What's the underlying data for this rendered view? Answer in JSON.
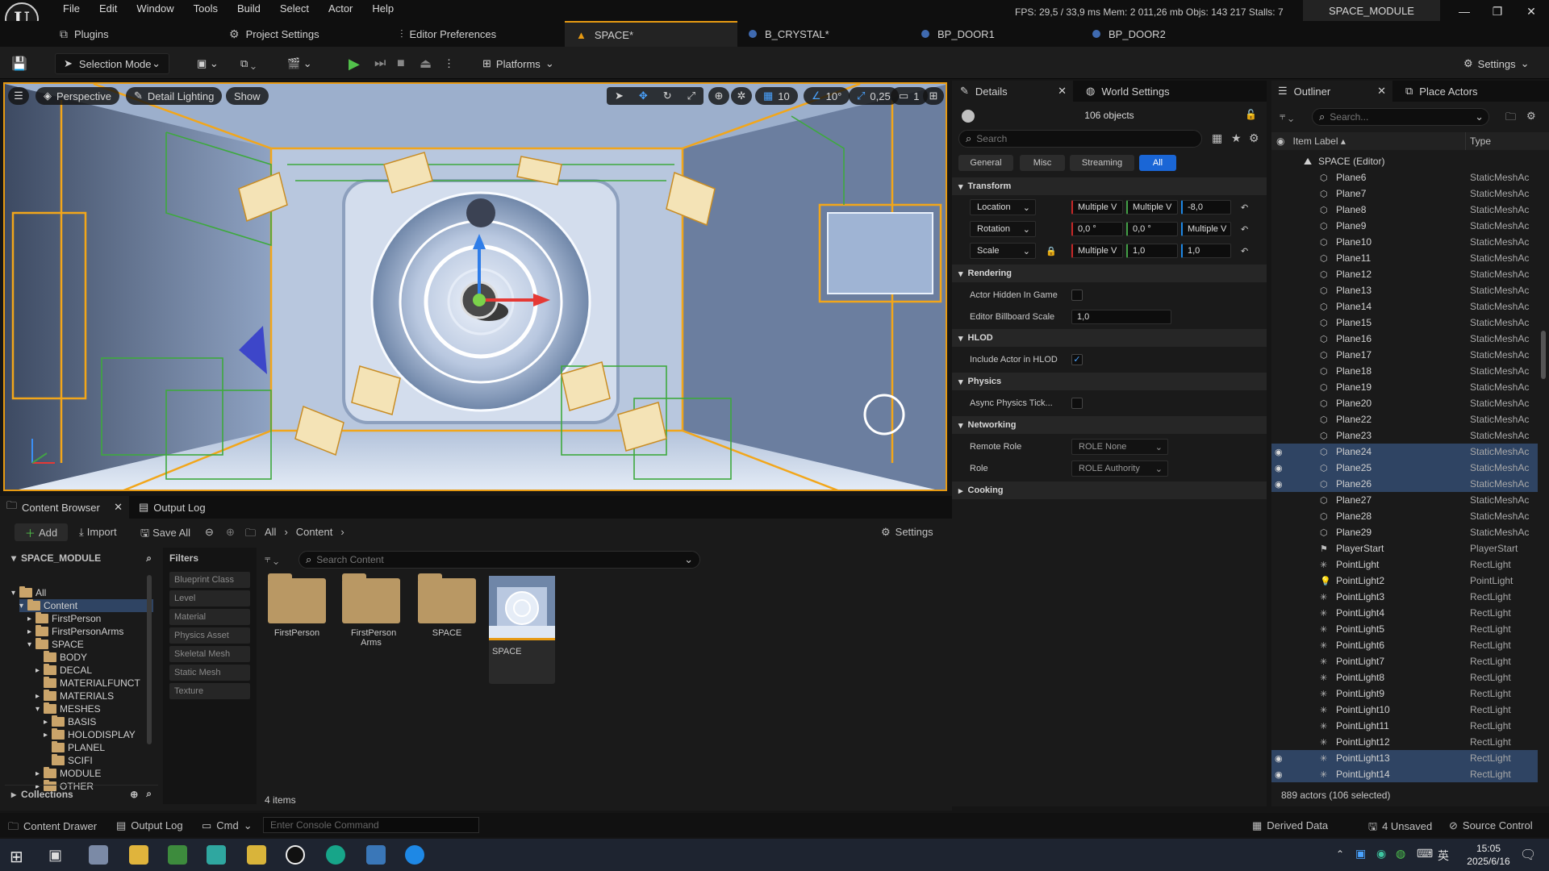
{
  "menu": [
    "File",
    "Edit",
    "Window",
    "Tools",
    "Build",
    "Select",
    "Actor",
    "Help"
  ],
  "stats": "FPS: 29,5  /  33,9 ms  Mem: 2 011,26 mb  Objs: 143 217  Stalls: 7",
  "project_name": "SPACE_MODULE",
  "toptabs": {
    "plugins": "Plugins",
    "project_settings": "Project Settings",
    "editor_preferences": "Editor Preferences"
  },
  "doc_tabs": [
    "SPACE*",
    "B_CRYSTAL*",
    "BP_DOOR1",
    "BP_DOOR2"
  ],
  "toolbar": {
    "selection_mode": "Selection Mode",
    "platforms": "Platforms",
    "settings": "Settings"
  },
  "viewport": {
    "perspective": "Perspective",
    "lighting": "Detail Lighting",
    "show": "Show",
    "grid": "10",
    "angle": "10°",
    "scale": "0,25",
    "camera": "1"
  },
  "details": {
    "tab": "Details",
    "world_tab": "World Settings",
    "count": "106 objects",
    "search_placeholder": "Search",
    "filters": [
      "General",
      "Misc",
      "Streaming",
      "All"
    ],
    "transform": {
      "title": "Transform",
      "location_label": "Location",
      "location": [
        "Multiple V",
        "Multiple V",
        "-8,0"
      ],
      "rotation_label": "Rotation",
      "rotation": [
        "0,0 °",
        "0,0 °",
        "Multiple V"
      ],
      "scale_label": "Scale",
      "scale": [
        "Multiple V",
        "1,0",
        "1,0"
      ]
    },
    "rendering": {
      "title": "Rendering",
      "hidden": "Actor Hidden In Game",
      "billboard": "Editor Billboard Scale",
      "billboard_value": "1,0"
    },
    "hlod": {
      "title": "HLOD",
      "include": "Include Actor in HLOD"
    },
    "physics": {
      "title": "Physics",
      "async": "Async Physics Tick..."
    },
    "networking": {
      "title": "Networking",
      "remote_role": "Remote Role",
      "remote_role_value": "ROLE None",
      "role": "Role",
      "role_value": "ROLE Authority"
    },
    "cooking": "Cooking"
  },
  "outliner": {
    "tab": "Outliner",
    "place_tab": "Place Actors",
    "search_placeholder": "Search...",
    "col_label": "Item Label ▴",
    "col_type": "Type",
    "root": "SPACE (Editor)",
    "rows": [
      {
        "name": "Plane6",
        "type": "StaticMeshAc",
        "sel": false,
        "icon": "mesh"
      },
      {
        "name": "Plane7",
        "type": "StaticMeshAc",
        "sel": false,
        "icon": "mesh"
      },
      {
        "name": "Plane8",
        "type": "StaticMeshAc",
        "sel": false,
        "icon": "mesh"
      },
      {
        "name": "Plane9",
        "type": "StaticMeshAc",
        "sel": false,
        "icon": "mesh"
      },
      {
        "name": "Plane10",
        "type": "StaticMeshAc",
        "sel": false,
        "icon": "mesh"
      },
      {
        "name": "Plane11",
        "type": "StaticMeshAc",
        "sel": false,
        "icon": "mesh"
      },
      {
        "name": "Plane12",
        "type": "StaticMeshAc",
        "sel": false,
        "icon": "mesh"
      },
      {
        "name": "Plane13",
        "type": "StaticMeshAc",
        "sel": false,
        "icon": "mesh"
      },
      {
        "name": "Plane14",
        "type": "StaticMeshAc",
        "sel": false,
        "icon": "mesh"
      },
      {
        "name": "Plane15",
        "type": "StaticMeshAc",
        "sel": false,
        "icon": "mesh"
      },
      {
        "name": "Plane16",
        "type": "StaticMeshAc",
        "sel": false,
        "icon": "mesh"
      },
      {
        "name": "Plane17",
        "type": "StaticMeshAc",
        "sel": false,
        "icon": "mesh"
      },
      {
        "name": "Plane18",
        "type": "StaticMeshAc",
        "sel": false,
        "icon": "mesh"
      },
      {
        "name": "Plane19",
        "type": "StaticMeshAc",
        "sel": false,
        "icon": "mesh"
      },
      {
        "name": "Plane20",
        "type": "StaticMeshAc",
        "sel": false,
        "icon": "mesh"
      },
      {
        "name": "Plane22",
        "type": "StaticMeshAc",
        "sel": false,
        "icon": "mesh"
      },
      {
        "name": "Plane23",
        "type": "StaticMeshAc",
        "sel": false,
        "icon": "mesh"
      },
      {
        "name": "Plane24",
        "type": "StaticMeshAc",
        "sel": true,
        "icon": "mesh"
      },
      {
        "name": "Plane25",
        "type": "StaticMeshAc",
        "sel": true,
        "icon": "mesh"
      },
      {
        "name": "Plane26",
        "type": "StaticMeshAc",
        "sel": true,
        "icon": "mesh"
      },
      {
        "name": "Plane27",
        "type": "StaticMeshAc",
        "sel": false,
        "icon": "mesh"
      },
      {
        "name": "Plane28",
        "type": "StaticMeshAc",
        "sel": false,
        "icon": "mesh"
      },
      {
        "name": "Plane29",
        "type": "StaticMeshAc",
        "sel": false,
        "icon": "mesh"
      },
      {
        "name": "PlayerStart",
        "type": "PlayerStart",
        "sel": false,
        "icon": "start"
      },
      {
        "name": "PointLight",
        "type": "RectLight",
        "sel": false,
        "icon": "light"
      },
      {
        "name": "PointLight2",
        "type": "PointLight",
        "sel": false,
        "icon": "bulb"
      },
      {
        "name": "PointLight3",
        "type": "RectLight",
        "sel": false,
        "icon": "light"
      },
      {
        "name": "PointLight4",
        "type": "RectLight",
        "sel": false,
        "icon": "light"
      },
      {
        "name": "PointLight5",
        "type": "RectLight",
        "sel": false,
        "icon": "light"
      },
      {
        "name": "PointLight6",
        "type": "RectLight",
        "sel": false,
        "icon": "light"
      },
      {
        "name": "PointLight7",
        "type": "RectLight",
        "sel": false,
        "icon": "light"
      },
      {
        "name": "PointLight8",
        "type": "RectLight",
        "sel": false,
        "icon": "light"
      },
      {
        "name": "PointLight9",
        "type": "RectLight",
        "sel": false,
        "icon": "light"
      },
      {
        "name": "PointLight10",
        "type": "RectLight",
        "sel": false,
        "icon": "light"
      },
      {
        "name": "PointLight11",
        "type": "RectLight",
        "sel": false,
        "icon": "light"
      },
      {
        "name": "PointLight12",
        "type": "RectLight",
        "sel": false,
        "icon": "light"
      },
      {
        "name": "PointLight13",
        "type": "RectLight",
        "sel": true,
        "icon": "light"
      },
      {
        "name": "PointLight14",
        "type": "RectLight",
        "sel": true,
        "icon": "light"
      }
    ],
    "footer": "889 actors (106 selected)"
  },
  "content_browser": {
    "tab": "Content Browser",
    "log_tab": "Output Log",
    "add": "Add",
    "import": "Import",
    "save_all": "Save All",
    "path": [
      "All",
      "Content"
    ],
    "settings": "Settings",
    "root": "SPACE_MODULE",
    "tree": [
      {
        "label": "All",
        "depth": 0
      },
      {
        "label": "Content",
        "depth": 1
      },
      {
        "label": "FirstPerson",
        "depth": 2
      },
      {
        "label": "FirstPersonArms",
        "depth": 2
      },
      {
        "label": "SPACE",
        "depth": 2
      },
      {
        "label": "BODY",
        "depth": 3
      },
      {
        "label": "DECAL",
        "depth": 3
      },
      {
        "label": "MATERIALFUNCT",
        "depth": 3
      },
      {
        "label": "MATERIALS",
        "depth": 3
      },
      {
        "label": "MESHES",
        "depth": 3
      },
      {
        "label": "BASIS",
        "depth": 4
      },
      {
        "label": "HOLODISPLAY",
        "depth": 4
      },
      {
        "label": "PLANEL",
        "depth": 4
      },
      {
        "label": "SCIFI",
        "depth": 4
      },
      {
        "label": "MODULE",
        "depth": 3
      },
      {
        "label": "OTHER",
        "depth": 3
      }
    ],
    "collections": "Collections",
    "filters_title": "Filters",
    "filters": [
      "Blueprint Class",
      "Level",
      "Material",
      "Physics Asset",
      "Skeletal Mesh",
      "Static Mesh",
      "Texture"
    ],
    "search_placeholder": "Search Content",
    "assets": [
      {
        "label": "FirstPerson",
        "kind": "folder"
      },
      {
        "label": "FirstPerson Arms",
        "kind": "folder"
      },
      {
        "label": "SPACE",
        "kind": "folder"
      },
      {
        "label": "SPACE",
        "kind": "level"
      }
    ],
    "items_count": "4 items"
  },
  "statusbar": {
    "drawer": "Content Drawer",
    "output": "Output Log",
    "cmd": "Cmd",
    "console_placeholder": "Enter Console Command",
    "derived": "Derived Data",
    "unsaved": "4 Unsaved",
    "source": "Source Control"
  },
  "taskbar": {
    "ime": "英",
    "time": "15:05",
    "date": "2025/6/16"
  }
}
